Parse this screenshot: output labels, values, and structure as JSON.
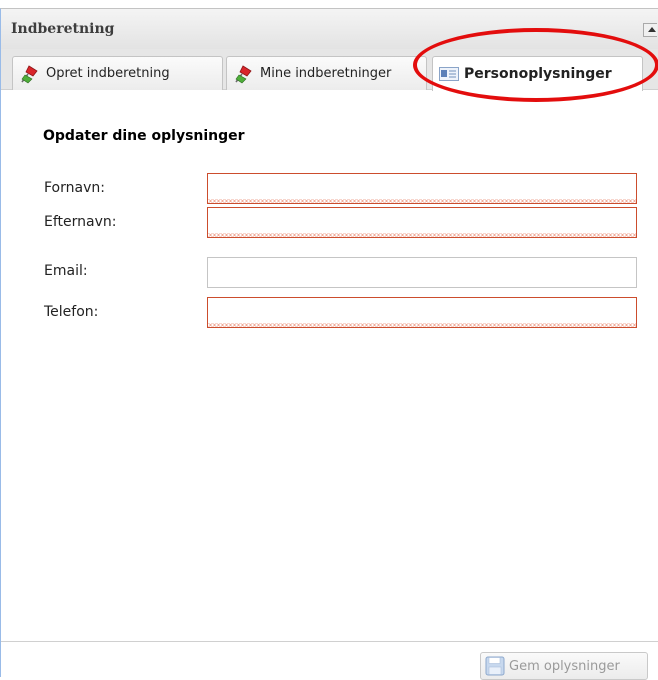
{
  "panel": {
    "title": "Indberetning",
    "collapse_icon": "triangle-up-icon"
  },
  "tabs": [
    {
      "label": "Opret indberetning",
      "icon": "pushpin-icon",
      "active": false
    },
    {
      "label": "Mine indberetninger",
      "icon": "pushpin-icon",
      "active": false
    },
    {
      "label": "Personoplysninger",
      "icon": "id-card-icon",
      "active": true
    }
  ],
  "form": {
    "title": "Opdater dine oplysninger",
    "fields": [
      {
        "label": "Fornavn:",
        "value": "",
        "invalid": true
      },
      {
        "label": "Efternavn:",
        "value": "",
        "invalid": true
      },
      {
        "label": "Email:",
        "value": "",
        "invalid": false
      },
      {
        "label": "Telefon:",
        "value": "",
        "invalid": true
      }
    ]
  },
  "footer": {
    "save_label": "Gem oplysninger",
    "save_icon": "floppy-disk-icon",
    "save_disabled": true
  },
  "colors": {
    "annotation_circle": "#e30d0d",
    "invalid_border": "#cc4d2d",
    "pin_red": "#d9262b",
    "pin_green": "#4fae3a"
  }
}
